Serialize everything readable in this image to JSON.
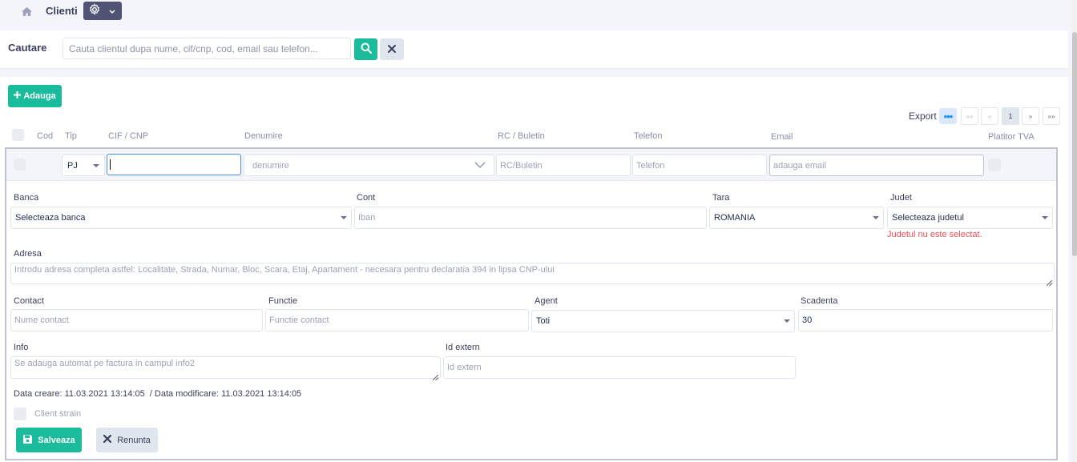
{
  "nav": {
    "breadcrumb": "Clienti",
    "home_icon": "home-icon",
    "settings_icon": "gear-icon"
  },
  "search": {
    "label": "Cautare",
    "placeholder": "Cauta clientul dupa nume, cif/cnp, cod, email sau telefon...",
    "value": ""
  },
  "toolbar": {
    "add_label": "Adauga",
    "export_label": "Export",
    "export_more": "•••"
  },
  "pagination": {
    "first": "««",
    "prev": "«",
    "current": "1",
    "next": "»",
    "last": "»»"
  },
  "table": {
    "headers": [
      "Cod",
      "Tip",
      "CIF / CNP",
      "Denumire",
      "RC / Buletin",
      "Telefon",
      "Email",
      "Platitor TVA"
    ]
  },
  "row": {
    "tip": "PJ",
    "cif": "",
    "denumire_placeholder": "denumire",
    "rc_placeholder": "RC/Buletin",
    "telefon_placeholder": "Telefon",
    "email_placeholder": "adauga email"
  },
  "form": {
    "banca": {
      "label": "Banca",
      "value": "Selecteaza banca"
    },
    "cont": {
      "label": "Cont",
      "placeholder": "Iban"
    },
    "tara": {
      "label": "Tara",
      "value": "ROMANIA"
    },
    "judet": {
      "label": "Judet",
      "value": "Selecteaza judetul",
      "error": "Judetul nu este selectat."
    },
    "adresa": {
      "label": "Adresa",
      "placeholder": "Introdu adresa completa astfel: Localitate, Strada, Numar, Bloc, Scara, Etaj, Apartament - necesara pentru declaratia 394 in lipsa CNP-ului"
    },
    "contact": {
      "label": "Contact",
      "placeholder": "Nume contact"
    },
    "functie": {
      "label": "Functie",
      "placeholder": "Functie contact"
    },
    "agent": {
      "label": "Agent",
      "value": "Toti"
    },
    "scadenta": {
      "label": "Scadenta",
      "value": "30"
    },
    "info": {
      "label": "Info",
      "placeholder": "Se adauga automat pe factura in campul info2"
    },
    "id_extern": {
      "label": "Id extern",
      "placeholder": "Id extern"
    },
    "meta": "Data creare: 11.03.2021 13:14:05  / Data modificare: 11.03.2021 13:14:05",
    "client_strain": "Client strain",
    "save_label": "Salveaza",
    "cancel_label": "Renunta"
  },
  "colors": {
    "accent": "#1abc9c",
    "nav_button": "#515375",
    "error": "#e7515a",
    "focus": "#4a90e2"
  }
}
